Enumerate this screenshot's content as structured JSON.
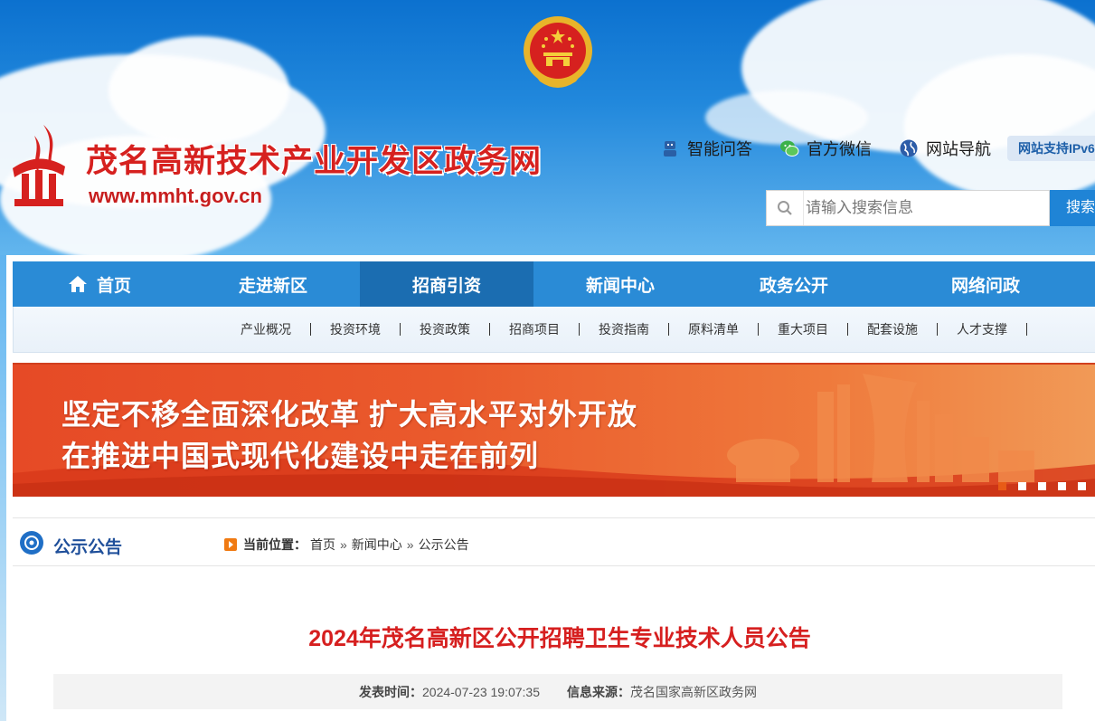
{
  "header": {
    "site_title": "茂名高新技术产业开发区政务网",
    "site_url": "www.mmht.gov.cn",
    "links": [
      {
        "label": "智能问答",
        "icon": "robot-icon"
      },
      {
        "label": "官方微信",
        "icon": "wechat-icon"
      },
      {
        "label": "网站导航",
        "icon": "globe-icon"
      }
    ],
    "ipv6_badge": "网站支持IPv6",
    "search": {
      "placeholder": "请输入搜索信息",
      "button": "搜索"
    }
  },
  "nav": {
    "items": [
      "首页",
      "走进新区",
      "招商引资",
      "新闻中心",
      "政务公开",
      "网络问政"
    ],
    "active": "招商引资"
  },
  "subnav": {
    "items": [
      "产业概况",
      "投资环境",
      "投资政策",
      "招商项目",
      "投资指南",
      "原料清单",
      "重大项目",
      "配套设施",
      "人才支撑"
    ]
  },
  "banner": {
    "line1": "坚定不移全面深化改革 扩大高水平对外开放",
    "line2": "在推进中国式现代化建设中走在前列",
    "slide_count": 5,
    "active_slide": 1
  },
  "section": {
    "title": "公示公告",
    "crumb_label": "当前位置：",
    "crumbs": [
      "首页",
      "新闻中心",
      "公示公告"
    ],
    "crumb_sep": "»"
  },
  "article": {
    "title": "2024年茂名高新区公开招聘卫生专业技术人员公告",
    "publish_label": "发表时间：",
    "publish_time": "2024-07-23 19:07:35",
    "source_label": "信息来源：",
    "source": "茂名国家高新区政务网"
  },
  "colors": {
    "nav_bg": "#2a8bd6",
    "nav_active": "#1b6db1",
    "title_red": "#d61f1f",
    "banner_orange": "#ea5a2c"
  }
}
